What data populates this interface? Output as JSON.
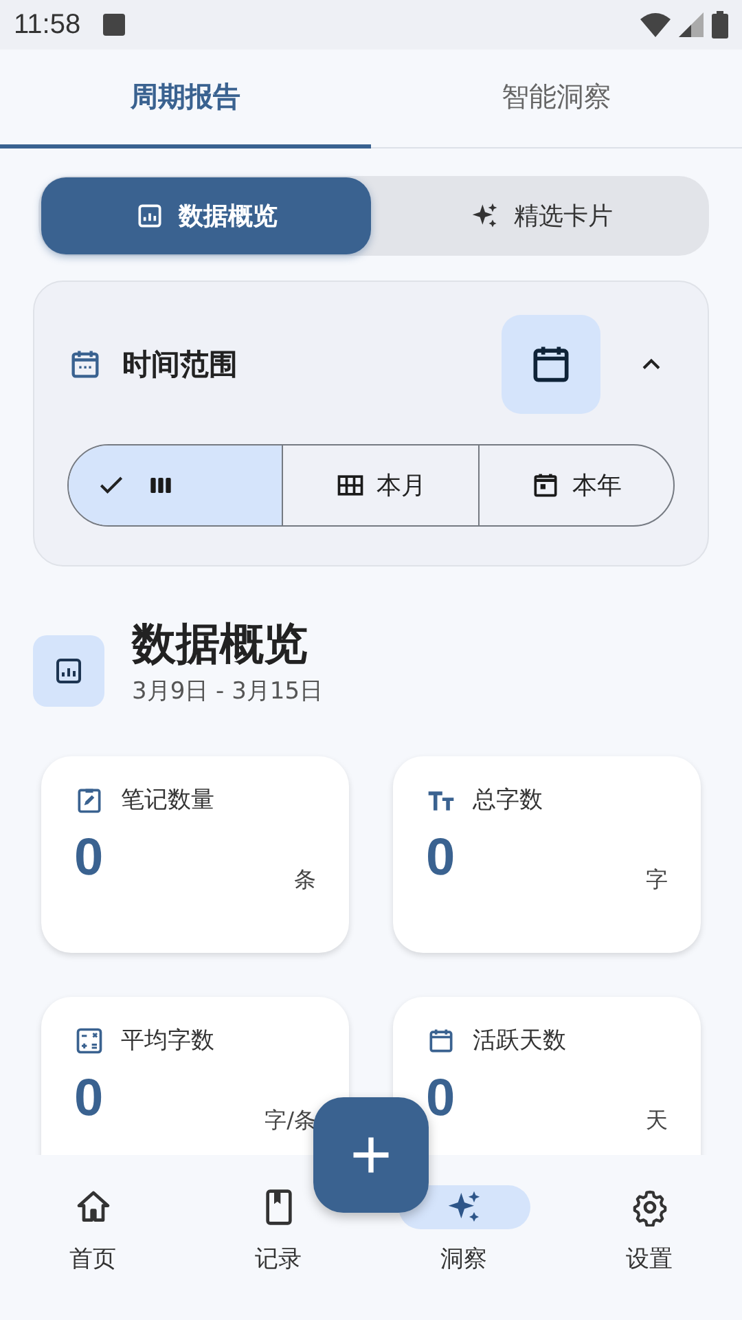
{
  "status_bar": {
    "time": "11:58"
  },
  "tabs": [
    {
      "label": "周期报告",
      "selected": true
    },
    {
      "label": "智能洞察",
      "selected": false
    }
  ],
  "view_toggle": [
    {
      "label": "数据概览",
      "selected": true
    },
    {
      "label": "精选卡片",
      "selected": false
    }
  ],
  "time_range": {
    "title": "时间范围",
    "expanded": true,
    "segments": [
      {
        "selected": true
      },
      {
        "label": "本月",
        "selected": false
      },
      {
        "label": "本年",
        "selected": false
      }
    ]
  },
  "overview": {
    "title": "数据概览",
    "date_range": "3月9日 - 3月15日"
  },
  "stats": [
    {
      "label": "笔记数量",
      "value": "0",
      "unit": "条"
    },
    {
      "label": "总字数",
      "value": "0",
      "unit": "字"
    },
    {
      "label": "平均字数",
      "value": "0",
      "unit": "字/条"
    },
    {
      "label": "活跃天数",
      "value": "0",
      "unit": "天"
    }
  ],
  "bottom_nav": [
    {
      "label": "首页",
      "selected": false
    },
    {
      "label": "记录",
      "selected": false
    },
    {
      "label": "洞察",
      "selected": true
    },
    {
      "label": "设置",
      "selected": false
    }
  ]
}
